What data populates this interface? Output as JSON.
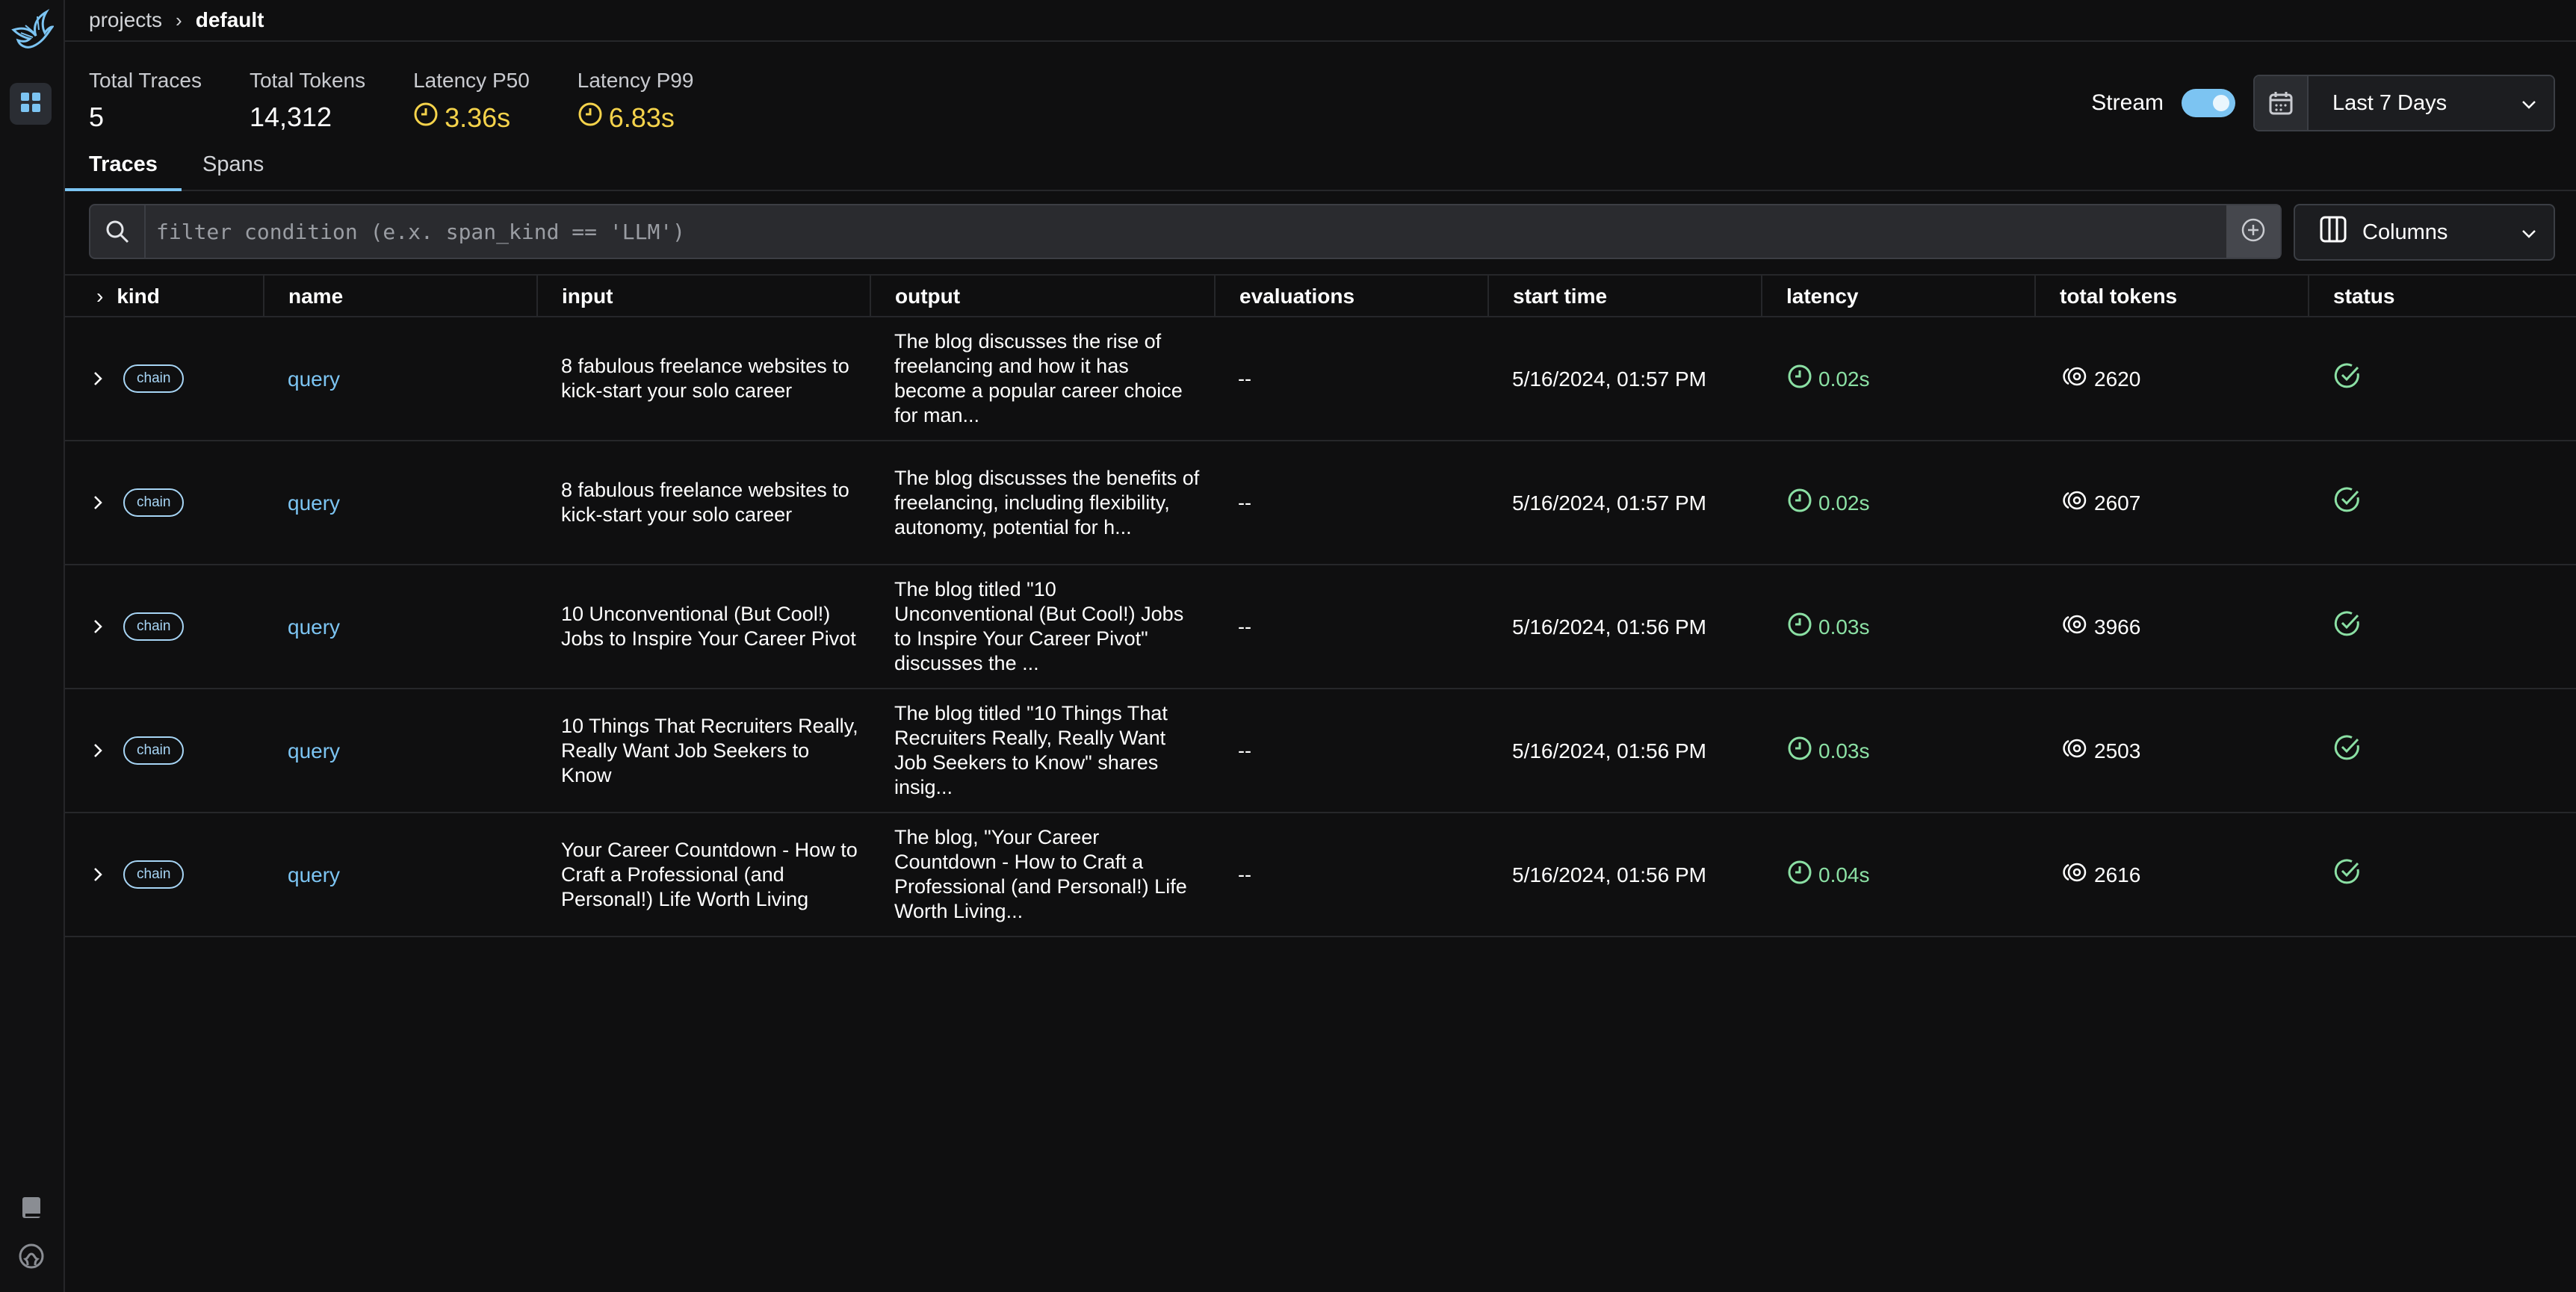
{
  "breadcrumb": {
    "root": "projects",
    "current": "default"
  },
  "stats": [
    {
      "label": "Total Traces",
      "value": "5",
      "warn": false
    },
    {
      "label": "Total Tokens",
      "value": "14,312",
      "warn": false
    },
    {
      "label": "Latency P50",
      "value": "3.36s",
      "warn": true
    },
    {
      "label": "Latency P99",
      "value": "6.83s",
      "warn": true
    }
  ],
  "stream": {
    "label": "Stream",
    "enabled": true
  },
  "date_range": {
    "value": "Last 7 Days"
  },
  "tabs": {
    "traces": "Traces",
    "spans": "Spans",
    "active": "Traces"
  },
  "filter": {
    "placeholder": "filter condition (e.x. span_kind == 'LLM')",
    "value": ""
  },
  "columns_button": "Columns",
  "table": {
    "headers": {
      "kind": "kind",
      "name": "name",
      "input": "input",
      "output": "output",
      "evaluations": "evaluations",
      "start_time": "start time",
      "latency": "latency",
      "total_tokens": "total tokens",
      "status": "status"
    },
    "rows": [
      {
        "kind": "chain",
        "name": "query",
        "input": "8 fabulous freelance websites to kick-start your solo career",
        "output": "The blog discusses the rise of freelancing and how it has become a popular career choice for man...",
        "evaluations": "--",
        "start_time": "5/16/2024, 01:57 PM",
        "latency": "0.02s",
        "total_tokens": "2620",
        "status": "ok"
      },
      {
        "kind": "chain",
        "name": "query",
        "input": "8 fabulous freelance websites to kick-start your solo career",
        "output": "The blog discusses the benefits of freelancing, including flexibility, autonomy, potential for h...",
        "evaluations": "--",
        "start_time": "5/16/2024, 01:57 PM",
        "latency": "0.02s",
        "total_tokens": "2607",
        "status": "ok"
      },
      {
        "kind": "chain",
        "name": "query",
        "input": "10 Unconventional (But Cool!) Jobs to Inspire Your Career Pivot",
        "output": "The blog titled \"10 Unconventional (But Cool!) Jobs to Inspire Your Career Pivot\" discusses the ...",
        "evaluations": "--",
        "start_time": "5/16/2024, 01:56 PM",
        "latency": "0.03s",
        "total_tokens": "3966",
        "status": "ok"
      },
      {
        "kind": "chain",
        "name": "query",
        "input": "10 Things That Recruiters Really, Really Want Job Seekers to Know",
        "output": "The blog titled \"10 Things That Recruiters Really, Really Want Job Seekers to Know\" shares insig...",
        "evaluations": "--",
        "start_time": "5/16/2024, 01:56 PM",
        "latency": "0.03s",
        "total_tokens": "2503",
        "status": "ok"
      },
      {
        "kind": "chain",
        "name": "query",
        "input": "Your Career Countdown - How to Craft a Professional (and Personal!) Life Worth Living",
        "output": "The blog, \"Your Career Countdown - How to Craft a Professional (and Personal!) Life Worth Living...",
        "evaluations": "--",
        "start_time": "5/16/2024, 01:56 PM",
        "latency": "0.04s",
        "total_tokens": "2616",
        "status": "ok"
      }
    ]
  },
  "icons": {
    "logo": "phoenix-bird-logo",
    "nav": "grid-icon",
    "docs": "book-icon",
    "github": "github-icon",
    "latency": "clock-icon",
    "tokens": "token-icon",
    "status_ok": "check-circle-icon"
  },
  "colors": {
    "accent": "#7cc4f2",
    "latency_stat": "#f5d34b",
    "latency_row": "#8be0a4",
    "status_ok": "#8be0a4",
    "background": "#0f0f10"
  }
}
